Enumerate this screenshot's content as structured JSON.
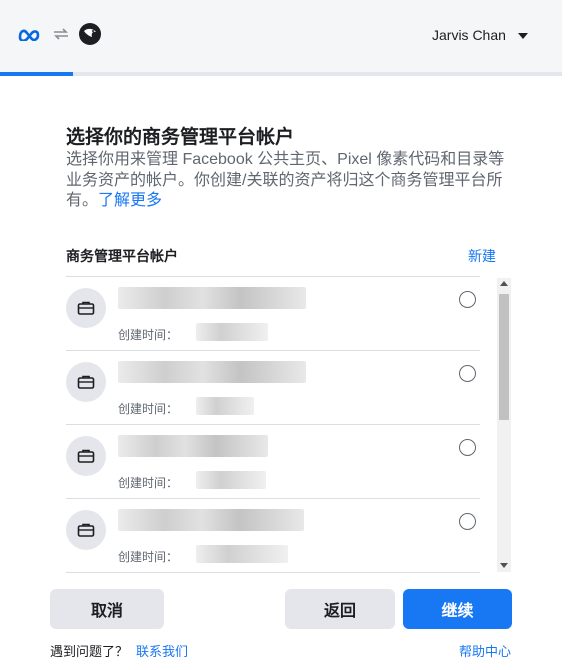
{
  "header": {
    "user_name": "Jarvis Chan",
    "progress_fraction": 0.13
  },
  "main": {
    "title": "选择你的商务管理平台帐户",
    "description": "选择你用来管理 Facebook 公共主页、Pixel 像素代码和目录等业务资产的帐户。你创建/关联的资产将归这个商务管理平台所有。",
    "learn_more": "了解更多"
  },
  "list": {
    "header": "商务管理平台帐户",
    "new_label": "新建",
    "items": [
      {
        "created_label": "创建时间：",
        "selected": false
      },
      {
        "created_label": "创建时间：",
        "selected": false
      },
      {
        "created_label": "创建时间：",
        "selected": false
      },
      {
        "created_label": "创建时间：",
        "selected": false
      }
    ]
  },
  "buttons": {
    "cancel": "取消",
    "back": "返回",
    "continue": "继续"
  },
  "footer": {
    "question": "遇到问题了？",
    "contact": "联系我们",
    "help": "帮助中心"
  },
  "colors": {
    "accent": "#1877f2",
    "secondary_button": "#e4e6eb"
  }
}
